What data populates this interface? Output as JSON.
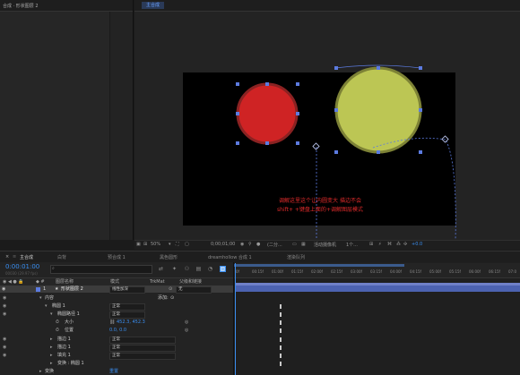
{
  "project_panel": {
    "tab_title": "合成 · 形状图层 2"
  },
  "viewer": {
    "tab_label": "主合成",
    "annotation_line1": "调解这里这个让内圆变大 描边不会",
    "annotation_line2": "shift+ +键盘上面的+调解图层模式",
    "colors": {
      "red_circle": "#cf2324",
      "red_stroke": "#8a2222",
      "yellow_circle": "#bcc654",
      "yellow_stroke": "#7d8236",
      "selection": "#5c7be0",
      "annotation": "#e02b2b"
    },
    "toolbar": {
      "zoom": "50%",
      "timecode": "0;00;01;00",
      "quality": "(二分...",
      "camera": "活动摄像机",
      "views": "1个...",
      "exposure": "+0.0"
    }
  },
  "timeline": {
    "tabs": [
      "主合成",
      "白背",
      "预合成 1",
      "黑色圆形",
      "dreamhollow 合成 1",
      "渲染队列"
    ],
    "timecode": "0:00:01:00",
    "timecode_sub": "00030 (29.97 fps)",
    "search_placeholder": "",
    "columns": {
      "source_name": "图层名称",
      "mode": "模式",
      "trkmat": "TrkMat",
      "parent": "父级和链接"
    },
    "layer": {
      "number": "1",
      "name": "形状图层 2",
      "mode": "线性加深",
      "parent": "无"
    },
    "properties": [
      {
        "label": "内容",
        "value": "",
        "add": "添加:"
      },
      {
        "label": "椭圆 1",
        "value": "正常"
      },
      {
        "label": "椭圆路径 1",
        "value": "正常"
      },
      {
        "label": "大小",
        "value": "452.3, 452.3"
      },
      {
        "label": "位置",
        "value": "0.0, 0.0"
      },
      {
        "label": "描边 1",
        "value": "正常"
      },
      {
        "label": "描边 1",
        "value": "正常"
      },
      {
        "label": "填充 1",
        "value": "正常"
      },
      {
        "label": "变换 : 椭圆 1",
        "value": ""
      },
      {
        "label": "变换",
        "value": "重置"
      }
    ],
    "ruler_ticks": [
      "0f",
      "00:15f",
      "01:00f",
      "01:15f",
      "02:00f",
      "02:15f",
      "03:00f",
      "03:15f",
      "04:00f",
      "04:15f",
      "05:00f",
      "05:15f",
      "06:00f",
      "06:15f",
      "07:0"
    ]
  }
}
